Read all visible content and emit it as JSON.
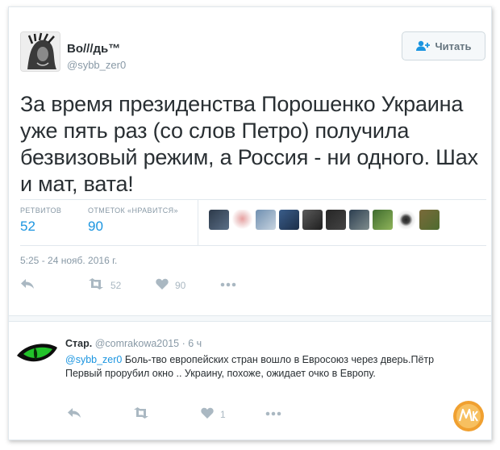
{
  "tweet": {
    "author_name": "Во///дь™",
    "author_handle": "@sybb_zer0",
    "follow_label": "Читать",
    "text": "За время президенства Порошенко Украина уже пять раз (со слов Петро) получила безвизовый режим, а Россия - ни одного. Шах и мат, вата!",
    "retweets_label": "РЕТВИТОВ",
    "retweets_count": "52",
    "likes_label": "ОТМЕТОК «НРАВИТСЯ»",
    "likes_count": "90",
    "timestamp": "5:25 - 24 нояб. 2016 г.",
    "actions": {
      "retweet_count": "52",
      "like_count": "90"
    }
  },
  "reply": {
    "author_name": "Стар.",
    "meta": "@comrakowa2015 · 6 ч",
    "mention": "@sybb_zer0",
    "text": " Боль-тво европейских стран вошло в Евросоюз через дверь.Пётр Первый прорубил окно .. Украину, похоже, ожидает очко в Европу.",
    "actions": {
      "like_count": "1"
    }
  },
  "colors": {
    "accent": "#1b95e0",
    "muted": "#8899a6",
    "text": "#292f33"
  }
}
